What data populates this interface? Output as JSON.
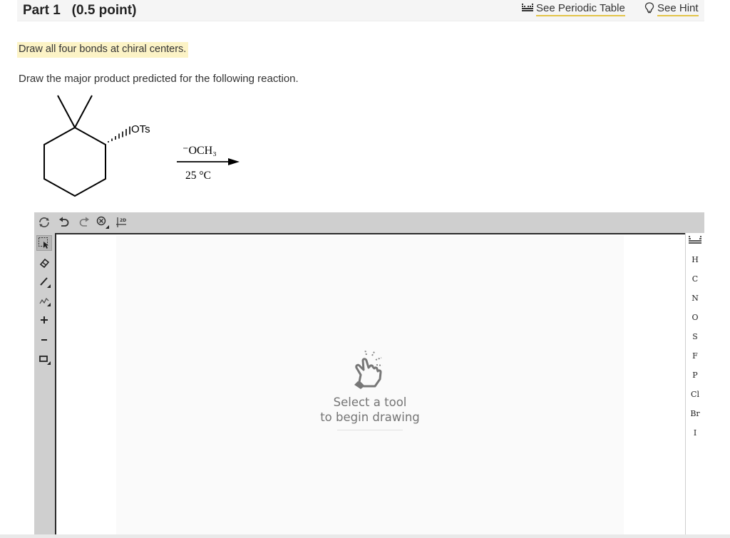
{
  "header": {
    "part_title": "Part 1   (0.5 point)",
    "periodic_table_label": "See Periodic Table",
    "hint_label": "See Hint"
  },
  "instruction": "Draw all four bonds at chiral centers.",
  "question": "Draw the major product predicted for the following reaction.",
  "reaction": {
    "substituent": "OTs",
    "reagent": "⁻OCH₃",
    "condition": "25 °C"
  },
  "editor": {
    "top_tools": [
      "clear-icon",
      "undo-icon",
      "redo-icon",
      "zoom-icon",
      "2d-template-icon"
    ],
    "twod_label": "2D",
    "left_tools": [
      "select-icon",
      "eraser-icon",
      "bond-icon",
      "chain-icon",
      "plus-charge-icon",
      "minus-charge-icon",
      "shape-icon"
    ],
    "placeholder_line1": "Select a tool",
    "placeholder_line2": "to begin drawing",
    "elements": [
      "H",
      "C",
      "N",
      "O",
      "S",
      "F",
      "P",
      "Cl",
      "Br",
      "I"
    ]
  }
}
